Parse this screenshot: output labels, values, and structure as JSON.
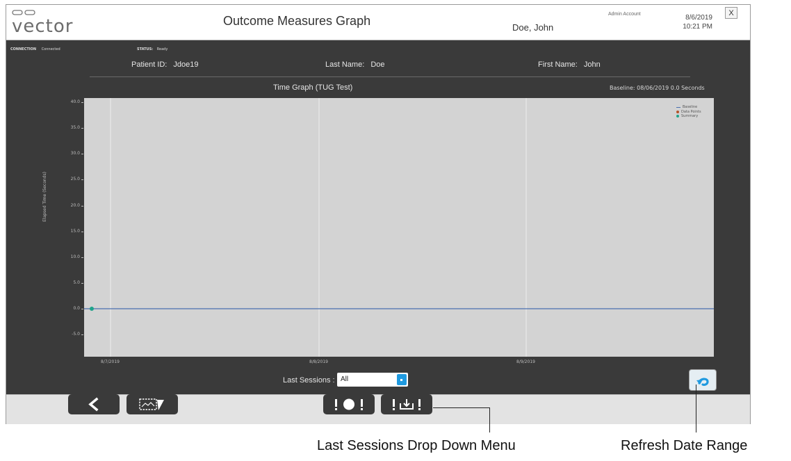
{
  "app": {
    "logo_alt": "vector",
    "window_title": "Outcome Measures Graph",
    "patient_name": "Doe, John",
    "account": "Admin Account",
    "date": "8/6/2019",
    "time": "10:21 PM",
    "close_label": "X"
  },
  "status_bar": {
    "connection_label": "CONNECTION",
    "connection_value": "Connected",
    "status_label": "STATUS:",
    "status_value": "Ready"
  },
  "patient": {
    "id_label": "Patient ID:",
    "id_value": "Jdoe19",
    "last_name_label": "Last Name:",
    "last_name_value": "Doe",
    "first_name_label": "First Name:",
    "first_name_value": "John"
  },
  "chart_data": {
    "type": "line",
    "title": "Time Graph (TUG Test)",
    "baseline_text": "Baseline: 08/06/2019  0.0 Seconds",
    "ylabel": "Elapsed Time (Seconds)",
    "ylim": [
      -7.5,
      40
    ],
    "yticks": [
      40.0,
      35.0,
      30.0,
      25.0,
      20.0,
      15.0,
      10.0,
      5.0,
      0.0,
      -5.0
    ],
    "ytick_labels": [
      "40.0",
      "35.0",
      "30.0",
      "25.0",
      "20.0",
      "15.0",
      "10.0",
      "5.0",
      "0.0",
      "-5.0"
    ],
    "xtick_labels": [
      "8/7/2019",
      "8/8/2019",
      "8/9/2019"
    ],
    "baseline_value": 0.0,
    "series": [
      {
        "name": "Baseline",
        "color": "#4a6fb0"
      },
      {
        "name": "Data Points",
        "color": "#b5532a"
      },
      {
        "name": "Summary",
        "color": "#1fa38a"
      }
    ],
    "data_points": [
      {
        "x": "8/6/2019",
        "y": 0.0
      }
    ],
    "grid": "vertical",
    "legend_position": "top-right"
  },
  "controls": {
    "last_sessions_label": "Last Sessions :",
    "last_sessions_value": "All"
  },
  "toolbar": {
    "buttons": [
      "back",
      "snapshot",
      "alert",
      "download"
    ]
  },
  "callouts": {
    "dropdown": "Last Sessions Drop Down Menu",
    "refresh": "Refresh Date Range"
  }
}
